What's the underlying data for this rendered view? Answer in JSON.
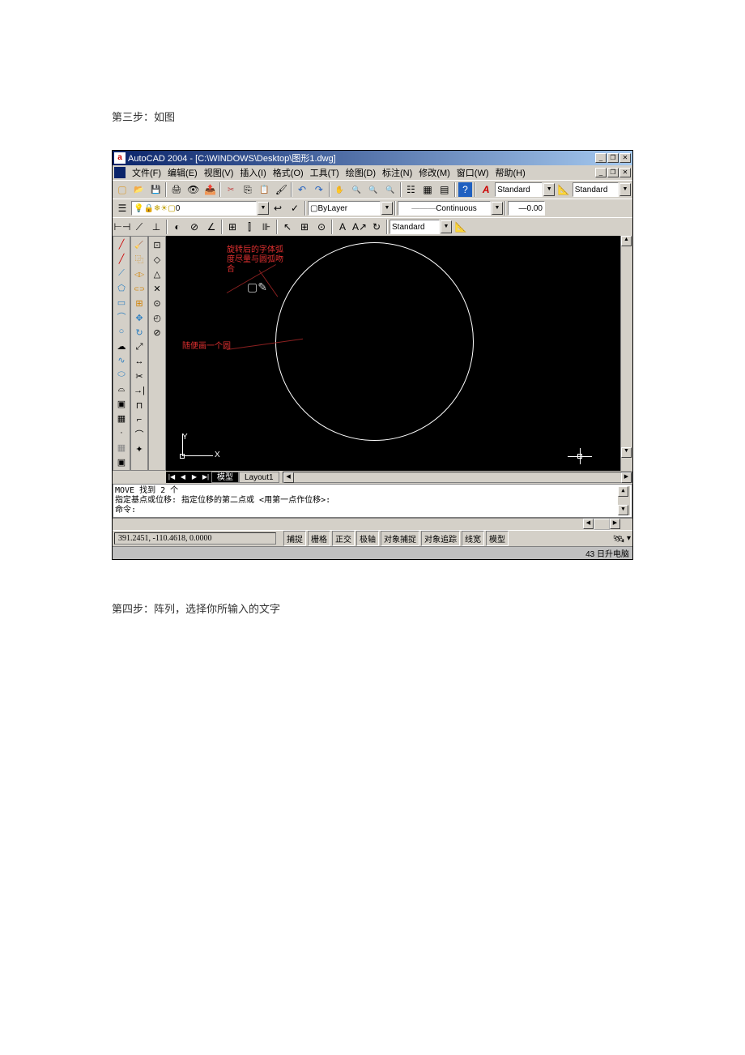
{
  "doc": {
    "step3_text": "第三步：如图",
    "step4_text": "第四步：阵列，选择你所输入的文字"
  },
  "titlebar": {
    "app_icon_text": "a",
    "title": "AutoCAD 2004 - [C:\\WINDOWS\\Desktop\\图形1.dwg]"
  },
  "menubar": {
    "items": [
      "文件(F)",
      "编辑(E)",
      "视图(V)",
      "插入(I)",
      "格式(O)",
      "工具(T)",
      "绘图(D)",
      "标注(N)",
      "修改(M)",
      "窗口(W)",
      "帮助(H)"
    ]
  },
  "toolbar_std": {
    "style1_label": "Standard",
    "style2_label": "Standard"
  },
  "toolbar_layer": {
    "layer_text": "0",
    "color_text": "ByLayer",
    "linetype_text": "Continuous",
    "lineweight_text": "0.00"
  },
  "toolbar_dim": {
    "style_text": "Standard"
  },
  "canvas": {
    "anno1": "旋转后的字体弧\n度尽量与圆弧吻\n合",
    "anno2": "随便画一个圆",
    "ucs_y": "Y",
    "ucs_x": "X"
  },
  "layout_tabs": {
    "active": "模型",
    "tab1": "Layout1"
  },
  "command": {
    "line1": "MOVE 找到 2 个",
    "line2": "指定基点或位移:  指定位移的第二点或 <用第一点作位移>:",
    "prompt": "命令:"
  },
  "statusbar": {
    "coords": "391.2451, -110.4618, 0.0000",
    "toggles": [
      "捕捉",
      "栅格",
      "正交",
      "极轴",
      "对象捕捉",
      "对象追踪",
      "线宽",
      "模型"
    ]
  },
  "taskbar": {
    "clock": "43 日升电脑"
  }
}
